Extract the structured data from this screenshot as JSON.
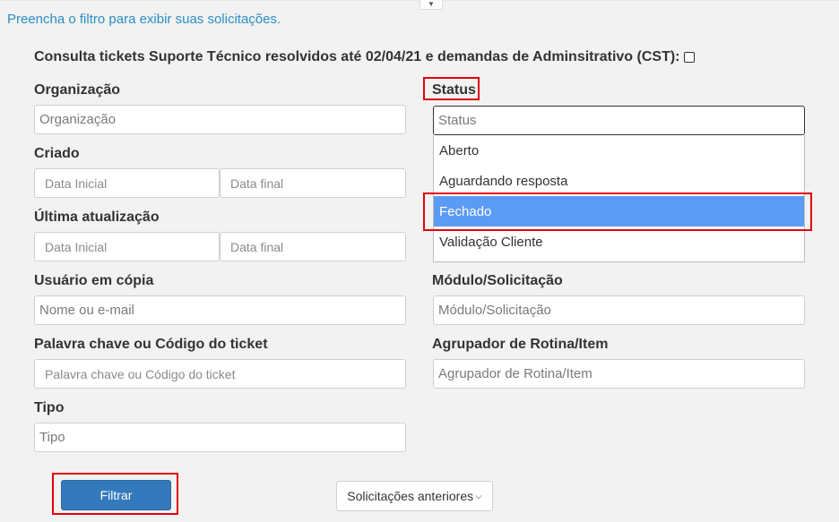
{
  "top_tab_icon": "caret-down",
  "hint": "Preencha o filtro para exibir suas solicitações.",
  "cst": {
    "label": "Consulta tickets Suporte Técnico resolvidos até 02/04/21 e demandas de Adminsitrativo (CST):",
    "checked": false
  },
  "organizacao": {
    "label": "Organização",
    "placeholder": "Organização"
  },
  "status": {
    "label": "Status",
    "placeholder": "Status",
    "options": [
      "Aberto",
      "Aguardando resposta",
      "Fechado",
      "Validação Cliente"
    ],
    "selected": "Fechado"
  },
  "criado": {
    "label": "Criado",
    "start_placeholder": "Data Inicial",
    "end_placeholder": "Data final"
  },
  "ultima_atualizacao": {
    "label": "Última atualização",
    "start_placeholder": "Data Inicial",
    "end_placeholder": "Data final"
  },
  "usuario_copia": {
    "label": "Usuário em cópia",
    "placeholder": "Nome ou e-mail"
  },
  "modulo": {
    "label": "Módulo/Solicitação",
    "placeholder": "Módulo/Solicitação"
  },
  "palavra_chave": {
    "label": "Palavra chave ou Código do ticket",
    "placeholder": "Palavra chave ou Código do ticket"
  },
  "agrupador": {
    "label": "Agrupador de Rotina/Item",
    "placeholder": "Agrupador de Rotina/Item"
  },
  "tipo": {
    "label": "Tipo",
    "placeholder": "Tipo"
  },
  "buttons": {
    "filtrar": "Filtrar",
    "anteriores": "Solicitações anteriores",
    "anteriores_icon": "chevron-down"
  },
  "colors": {
    "link": "#2a8ec2",
    "primary": "#3479bc",
    "selected": "#5b9bf3",
    "highlight": "#e3000f"
  }
}
